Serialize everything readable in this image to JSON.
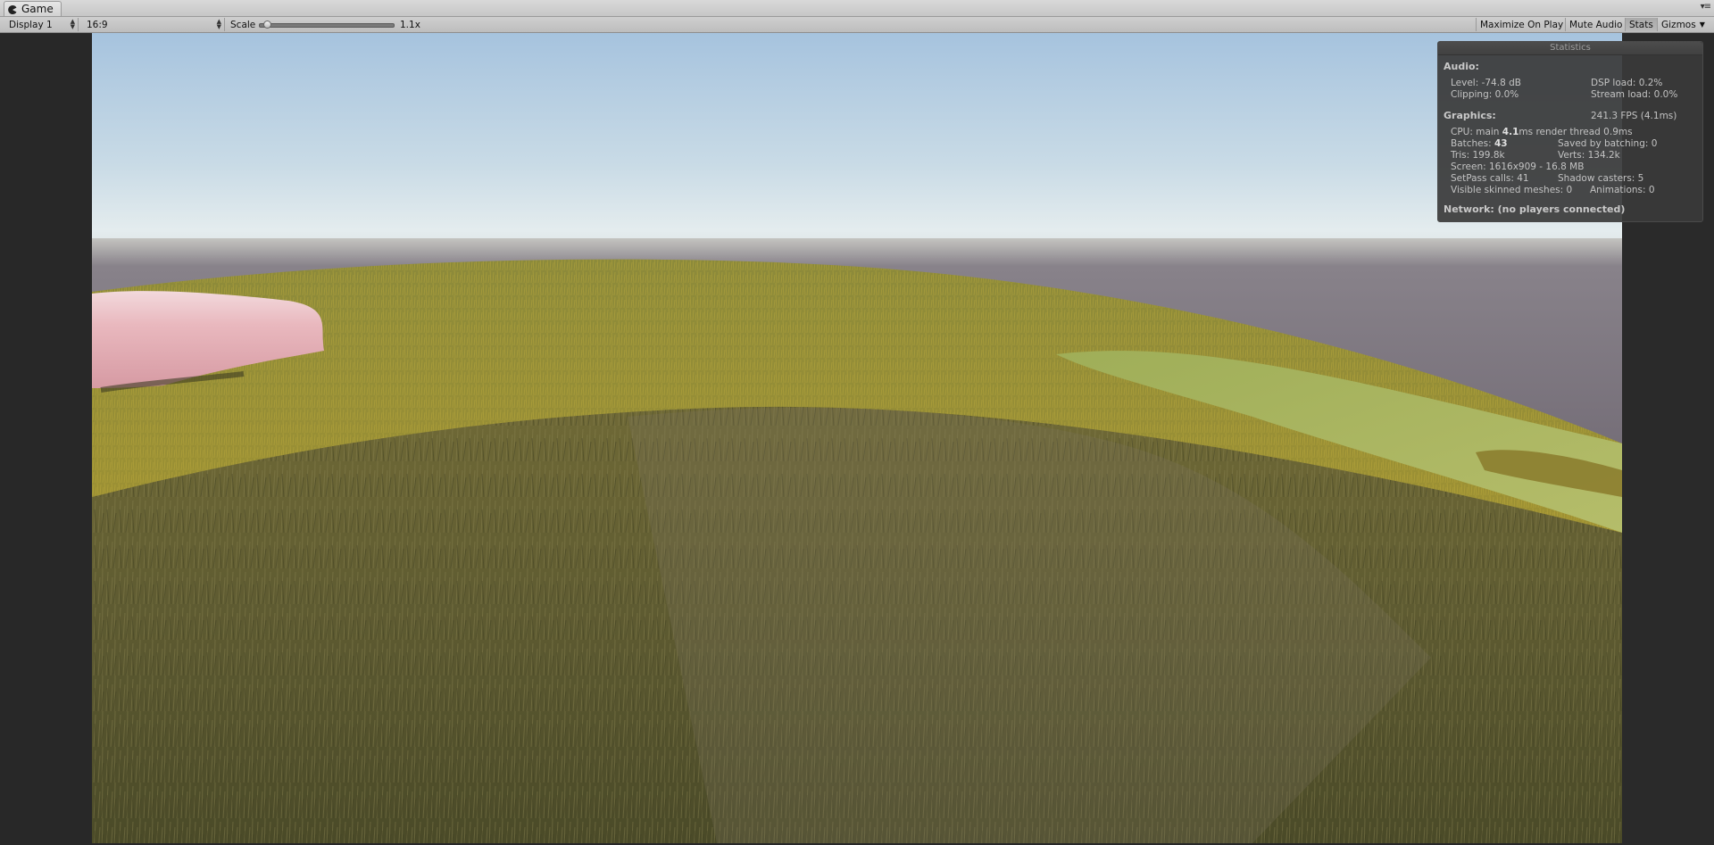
{
  "window": {
    "tab_title": "Game",
    "tab_menu_glyph": "▾≡",
    "tab_icon": "pacman-game-icon"
  },
  "toolbar": {
    "display_value": "Display 1",
    "aspect_value": "16:9",
    "scale_label": "Scale",
    "scale_value": "1.1x",
    "scale_fraction": 0.03,
    "maximize_label": "Maximize On Play",
    "mute_label": "Mute Audio",
    "stats_label": "Stats",
    "gizmos_label": "Gizmos",
    "popup_arrow_icon": "updown-arrows-icon",
    "gizmos_arrow_icon": "dropdown-arrow-icon"
  },
  "stats": {
    "title": "Statistics",
    "audio_heading": "Audio:",
    "level": "Level: -74.8 dB",
    "clipping": "Clipping: 0.0%",
    "dsp_load": "DSP load: 0.2%",
    "stream_load": "Stream load: 0.0%",
    "graphics_heading": "Graphics:",
    "fps": "241.3 FPS (4.1ms)",
    "cpu_prefix": "CPU: main ",
    "cpu_main": "4.1",
    "cpu_suffix": "ms  render thread 0.9ms",
    "batches_prefix": "Batches: ",
    "batches_value": "43",
    "saved_by_batching": "Saved by batching: 0",
    "tris": "Tris: 199.8k",
    "verts": "Verts: 134.2k",
    "screen": "Screen: 1616x909 - 16.8 MB",
    "setpass": "SetPass calls: 41",
    "shadow_casters": "Shadow casters: 5",
    "skinned_meshes": "Visible skinned meshes: 0",
    "animations": "Animations: 0",
    "network": "Network: (no players connected)"
  },
  "colors": {
    "sky_top": "#a6c3de",
    "sky_horizon": "#e8eef0",
    "ground_far": "#77707a",
    "grass_dark": "#5c5a2c",
    "grass_yellow": "#a49530",
    "grass_light": "#a8b45a",
    "rock_pink": "#e5a8b0",
    "editor_bg": "#282828"
  }
}
